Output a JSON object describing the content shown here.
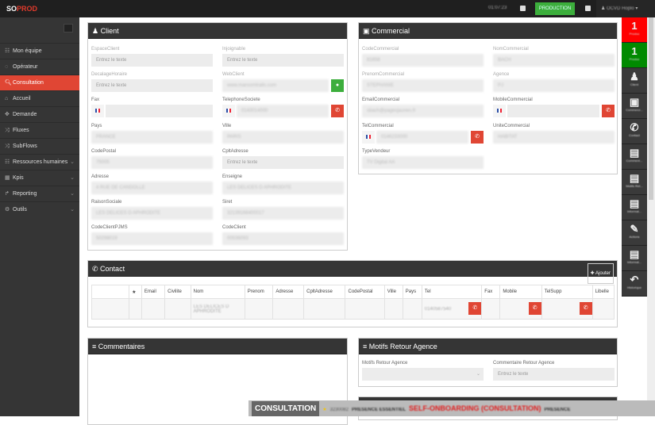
{
  "app": {
    "logo_a": "SO",
    "logo_b": "PROD",
    "clock": "01:07:23",
    "env": "PRODUCTION",
    "user": "OCVD Hoplo"
  },
  "sidebar": {
    "items": [
      {
        "label": "Mon équipe",
        "icon": "users-icon",
        "sub": false
      },
      {
        "label": "Opérateur",
        "icon": "headset-icon",
        "sub": false
      },
      {
        "label": "Consultation",
        "icon": "search-icon",
        "sub": false,
        "active": true
      },
      {
        "label": "Accueil",
        "icon": "home-icon",
        "sub": false
      },
      {
        "label": "Demande",
        "icon": "pin-icon",
        "sub": false
      },
      {
        "label": "Fluxes",
        "icon": "shuffle-icon",
        "sub": false
      },
      {
        "label": "SubFlows",
        "icon": "shuffle-icon",
        "sub": false
      },
      {
        "label": "Ressources humaines",
        "icon": "users-icon",
        "sub": true
      },
      {
        "label": "Kpis",
        "icon": "grid-icon",
        "sub": true
      },
      {
        "label": "Reporting",
        "icon": "share-icon",
        "sub": true
      },
      {
        "label": "Outils",
        "icon": "cogs-icon",
        "sub": true
      }
    ]
  },
  "client": {
    "title": "Client",
    "fields": [
      {
        "label": "EspaceClient",
        "value": "",
        "placeholder": "Entrez le texte"
      },
      {
        "label": "Injoignable",
        "value": "",
        "placeholder": "Entrez le texte"
      },
      {
        "label": "DecalageHoraire",
        "value": "",
        "placeholder": "Entrez le texte"
      },
      {
        "label": "WebClient",
        "value": "www.maroomtrails.com"
      },
      {
        "label": "Fax",
        "value": ""
      },
      {
        "label": "TelephoneSociete",
        "value": "0143014000"
      },
      {
        "label": "Pays",
        "value": "FRANCE"
      },
      {
        "label": "Ville",
        "value": "PARIS"
      },
      {
        "label": "CodePostal",
        "value": "75005"
      },
      {
        "label": "CpltAdresse",
        "value": "",
        "placeholder": "Entrez le texte"
      },
      {
        "label": "Adresse",
        "value": "4 RUE DE CANDOLLE"
      },
      {
        "label": "Enseigne",
        "value": "LES DELICES D APHRODITE"
      },
      {
        "label": "RaisonSociale",
        "value": "LES DELICES D APHRODITE"
      },
      {
        "label": "Siret",
        "value": "32139168400017"
      },
      {
        "label": "CodeClientPJMS",
        "value": "50298019"
      },
      {
        "label": "CodeClient",
        "value": "00536093"
      }
    ]
  },
  "commercial": {
    "title": "Commercial",
    "fields": [
      {
        "label": "CodeCommercial",
        "value": "81658"
      },
      {
        "label": "NomCommercial",
        "value": "BACH"
      },
      {
        "label": "PrenomCommercial",
        "value": "STEPHANIE"
      },
      {
        "label": "Agence",
        "value": "PJ"
      },
      {
        "label": "EmailCommercial",
        "value": "sbach@pagesjaunes.fr"
      },
      {
        "label": "MobileCommercial",
        "value": ""
      },
      {
        "label": "TelCommercial",
        "value": "0146233000"
      },
      {
        "label": "UniteCommercial",
        "value": "HABITAT"
      },
      {
        "label": "TypeVendeur",
        "value": "TV Digital AA"
      }
    ]
  },
  "contact": {
    "title": "Contact",
    "add": "Ajouter",
    "columns": [
      "",
      "★",
      "Email",
      "Civilite",
      "Nom",
      "Prenom",
      "Adresse",
      "CpltAdresse",
      "CodePostal",
      "Ville",
      "Pays",
      "Tel",
      "Fax",
      "Mobile",
      "TelSupp",
      "Libelle"
    ],
    "row": {
      "nom": "LES DELICES D APHRODITE",
      "tel": "0140587540"
    }
  },
  "commentaires": {
    "title": "Commentaires"
  },
  "motifs": {
    "title": "Motifs Retour Agence",
    "select_label": "Motifs Retour Agence",
    "comment_label": "Commentaire Retour Agence",
    "comment_placeholder": "Entrez le texte"
  },
  "rail": [
    {
      "count": "1",
      "label": "Prodoc",
      "color": "#ff0000"
    },
    {
      "count": "1",
      "label": "Prodoc",
      "color": "#008a00"
    },
    {
      "label": "Client",
      "icon": "user-icon"
    },
    {
      "label": "Commerci...",
      "icon": "briefcase-icon"
    },
    {
      "label": "Contact",
      "icon": "phone-icon"
    },
    {
      "label": "Comment...",
      "icon": "list-icon"
    },
    {
      "label": "Motifs Ret...",
      "icon": "list-icon"
    },
    {
      "label": "Informat...",
      "icon": "list-icon"
    },
    {
      "label": "Actions",
      "icon": "edit-icon"
    },
    {
      "label": "Informat...",
      "icon": "list-icon"
    },
    {
      "label": "Historique",
      "icon": "reply-icon"
    }
  ],
  "ticker": {
    "label": "CONSULTATION",
    "items": [
      "3230082",
      "PRESENCE ESSENTIEL",
      "SELF-ONBOARDING (CONSULTATION)",
      "PRESENCE"
    ]
  },
  "colors": {
    "accent": "#e04634",
    "green": "#3cae3c",
    "dark": "#353535"
  }
}
